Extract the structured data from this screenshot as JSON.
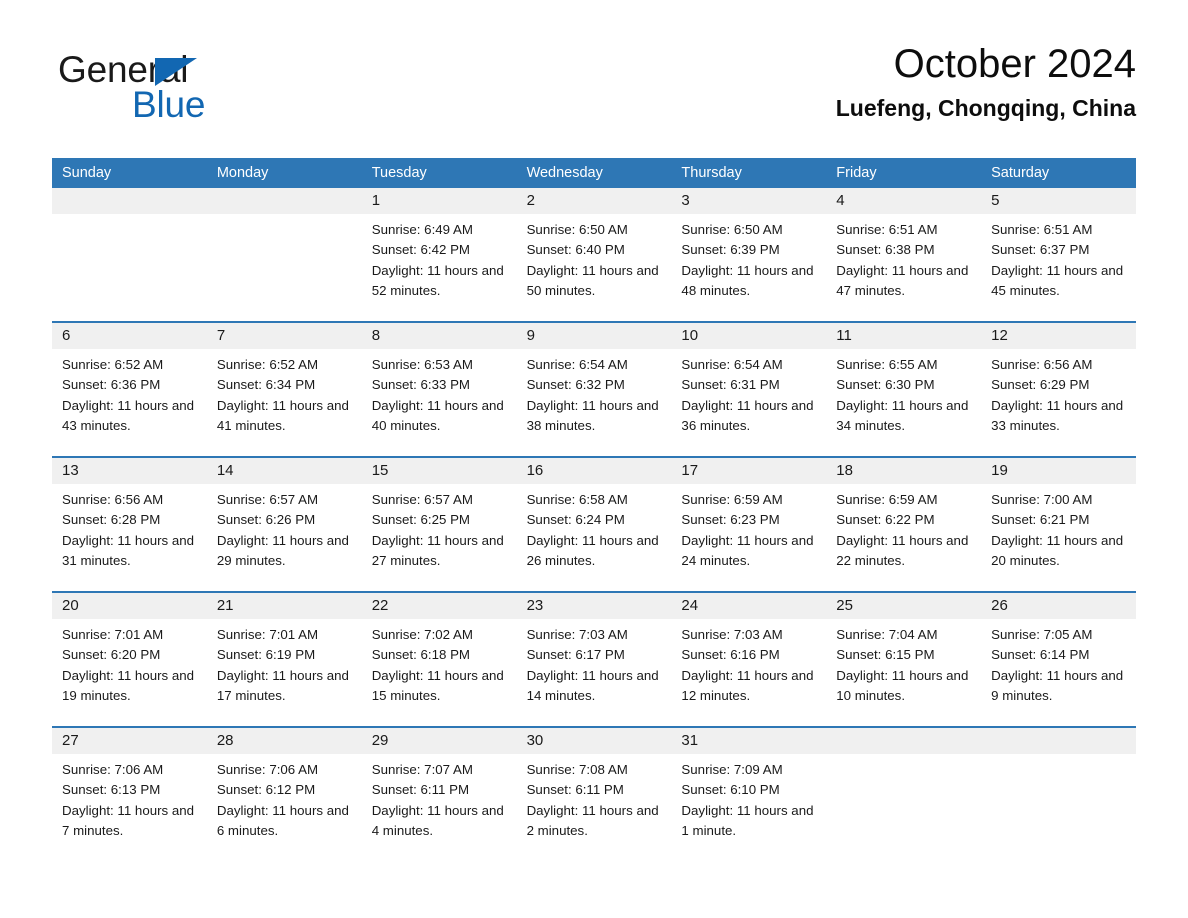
{
  "brand": {
    "name_part1": "General",
    "name_part2": "Blue",
    "triangle_icon": "triangle-icon",
    "color_blue": "#1267b2",
    "color_black": "#1a1a1a"
  },
  "header": {
    "month_title": "October 2024",
    "location_title": "Luefeng, Chongqing, China"
  },
  "theme": {
    "header_blue": "#2e77b5",
    "day_band_gray": "#f0f0f0",
    "text_color": "#1a1a1a",
    "background": "#ffffff"
  },
  "calendar": {
    "weekdays": [
      "Sunday",
      "Monday",
      "Tuesday",
      "Wednesday",
      "Thursday",
      "Friday",
      "Saturday"
    ],
    "weeks": [
      [
        {
          "day": "",
          "sunrise": "",
          "sunset": "",
          "daylight": ""
        },
        {
          "day": "",
          "sunrise": "",
          "sunset": "",
          "daylight": ""
        },
        {
          "day": "1",
          "sunrise": "Sunrise: 6:49 AM",
          "sunset": "Sunset: 6:42 PM",
          "daylight": "Daylight: 11 hours and 52 minutes."
        },
        {
          "day": "2",
          "sunrise": "Sunrise: 6:50 AM",
          "sunset": "Sunset: 6:40 PM",
          "daylight": "Daylight: 11 hours and 50 minutes."
        },
        {
          "day": "3",
          "sunrise": "Sunrise: 6:50 AM",
          "sunset": "Sunset: 6:39 PM",
          "daylight": "Daylight: 11 hours and 48 minutes."
        },
        {
          "day": "4",
          "sunrise": "Sunrise: 6:51 AM",
          "sunset": "Sunset: 6:38 PM",
          "daylight": "Daylight: 11 hours and 47 minutes."
        },
        {
          "day": "5",
          "sunrise": "Sunrise: 6:51 AM",
          "sunset": "Sunset: 6:37 PM",
          "daylight": "Daylight: 11 hours and 45 minutes."
        }
      ],
      [
        {
          "day": "6",
          "sunrise": "Sunrise: 6:52 AM",
          "sunset": "Sunset: 6:36 PM",
          "daylight": "Daylight: 11 hours and 43 minutes."
        },
        {
          "day": "7",
          "sunrise": "Sunrise: 6:52 AM",
          "sunset": "Sunset: 6:34 PM",
          "daylight": "Daylight: 11 hours and 41 minutes."
        },
        {
          "day": "8",
          "sunrise": "Sunrise: 6:53 AM",
          "sunset": "Sunset: 6:33 PM",
          "daylight": "Daylight: 11 hours and 40 minutes."
        },
        {
          "day": "9",
          "sunrise": "Sunrise: 6:54 AM",
          "sunset": "Sunset: 6:32 PM",
          "daylight": "Daylight: 11 hours and 38 minutes."
        },
        {
          "day": "10",
          "sunrise": "Sunrise: 6:54 AM",
          "sunset": "Sunset: 6:31 PM",
          "daylight": "Daylight: 11 hours and 36 minutes."
        },
        {
          "day": "11",
          "sunrise": "Sunrise: 6:55 AM",
          "sunset": "Sunset: 6:30 PM",
          "daylight": "Daylight: 11 hours and 34 minutes."
        },
        {
          "day": "12",
          "sunrise": "Sunrise: 6:56 AM",
          "sunset": "Sunset: 6:29 PM",
          "daylight": "Daylight: 11 hours and 33 minutes."
        }
      ],
      [
        {
          "day": "13",
          "sunrise": "Sunrise: 6:56 AM",
          "sunset": "Sunset: 6:28 PM",
          "daylight": "Daylight: 11 hours and 31 minutes."
        },
        {
          "day": "14",
          "sunrise": "Sunrise: 6:57 AM",
          "sunset": "Sunset: 6:26 PM",
          "daylight": "Daylight: 11 hours and 29 minutes."
        },
        {
          "day": "15",
          "sunrise": "Sunrise: 6:57 AM",
          "sunset": "Sunset: 6:25 PM",
          "daylight": "Daylight: 11 hours and 27 minutes."
        },
        {
          "day": "16",
          "sunrise": "Sunrise: 6:58 AM",
          "sunset": "Sunset: 6:24 PM",
          "daylight": "Daylight: 11 hours and 26 minutes."
        },
        {
          "day": "17",
          "sunrise": "Sunrise: 6:59 AM",
          "sunset": "Sunset: 6:23 PM",
          "daylight": "Daylight: 11 hours and 24 minutes."
        },
        {
          "day": "18",
          "sunrise": "Sunrise: 6:59 AM",
          "sunset": "Sunset: 6:22 PM",
          "daylight": "Daylight: 11 hours and 22 minutes."
        },
        {
          "day": "19",
          "sunrise": "Sunrise: 7:00 AM",
          "sunset": "Sunset: 6:21 PM",
          "daylight": "Daylight: 11 hours and 20 minutes."
        }
      ],
      [
        {
          "day": "20",
          "sunrise": "Sunrise: 7:01 AM",
          "sunset": "Sunset: 6:20 PM",
          "daylight": "Daylight: 11 hours and 19 minutes."
        },
        {
          "day": "21",
          "sunrise": "Sunrise: 7:01 AM",
          "sunset": "Sunset: 6:19 PM",
          "daylight": "Daylight: 11 hours and 17 minutes."
        },
        {
          "day": "22",
          "sunrise": "Sunrise: 7:02 AM",
          "sunset": "Sunset: 6:18 PM",
          "daylight": "Daylight: 11 hours and 15 minutes."
        },
        {
          "day": "23",
          "sunrise": "Sunrise: 7:03 AM",
          "sunset": "Sunset: 6:17 PM",
          "daylight": "Daylight: 11 hours and 14 minutes."
        },
        {
          "day": "24",
          "sunrise": "Sunrise: 7:03 AM",
          "sunset": "Sunset: 6:16 PM",
          "daylight": "Daylight: 11 hours and 12 minutes."
        },
        {
          "day": "25",
          "sunrise": "Sunrise: 7:04 AM",
          "sunset": "Sunset: 6:15 PM",
          "daylight": "Daylight: 11 hours and 10 minutes."
        },
        {
          "day": "26",
          "sunrise": "Sunrise: 7:05 AM",
          "sunset": "Sunset: 6:14 PM",
          "daylight": "Daylight: 11 hours and 9 minutes."
        }
      ],
      [
        {
          "day": "27",
          "sunrise": "Sunrise: 7:06 AM",
          "sunset": "Sunset: 6:13 PM",
          "daylight": "Daylight: 11 hours and 7 minutes."
        },
        {
          "day": "28",
          "sunrise": "Sunrise: 7:06 AM",
          "sunset": "Sunset: 6:12 PM",
          "daylight": "Daylight: 11 hours and 6 minutes."
        },
        {
          "day": "29",
          "sunrise": "Sunrise: 7:07 AM",
          "sunset": "Sunset: 6:11 PM",
          "daylight": "Daylight: 11 hours and 4 minutes."
        },
        {
          "day": "30",
          "sunrise": "Sunrise: 7:08 AM",
          "sunset": "Sunset: 6:11 PM",
          "daylight": "Daylight: 11 hours and 2 minutes."
        },
        {
          "day": "31",
          "sunrise": "Sunrise: 7:09 AM",
          "sunset": "Sunset: 6:10 PM",
          "daylight": "Daylight: 11 hours and 1 minute."
        },
        {
          "day": "",
          "sunrise": "",
          "sunset": "",
          "daylight": ""
        },
        {
          "day": "",
          "sunrise": "",
          "sunset": "",
          "daylight": ""
        }
      ]
    ]
  }
}
